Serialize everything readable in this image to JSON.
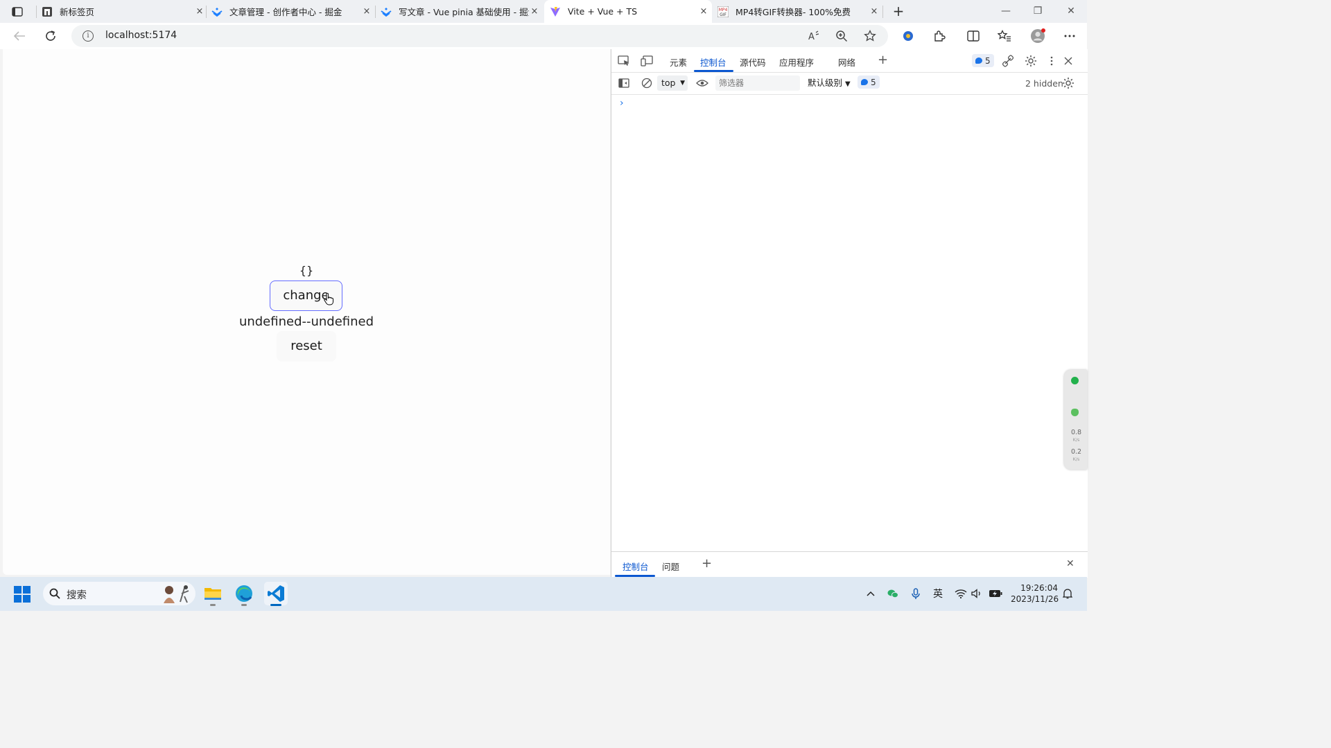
{
  "browser": {
    "tabs": [
      {
        "title": "新标签页",
        "favicon": "newtab-page-icon",
        "active": false
      },
      {
        "title": "文章管理 - 创作者中心 - 掘金",
        "favicon": "juejin-icon",
        "active": false
      },
      {
        "title": "写文章 - Vue pinia 基础使用 - 掘金",
        "favicon": "juejin-icon",
        "active": false
      },
      {
        "title": "Vite + Vue + TS",
        "favicon": "vite-icon",
        "active": true
      },
      {
        "title": "MP4转GIF转换器- 100%免费",
        "favicon": "mp4-gif-icon",
        "active": false
      }
    ],
    "tab_close_glyph": "×",
    "new_tab_glyph": "+",
    "address": "localhost:5174",
    "window_controls": {
      "minimize": "—",
      "maximize": "❐",
      "close": "✕"
    }
  },
  "page": {
    "json_output": "{}",
    "change_button": "change",
    "status_text": "undefined--undefined",
    "reset_button": "reset"
  },
  "devtools": {
    "tabs": [
      "元素",
      "控制台",
      "源代码",
      "应用程序",
      "网络"
    ],
    "active_tab": "控制台",
    "add_tab_glyph": "+",
    "message_count": "5",
    "context": "top",
    "filter_placeholder": "筛选器",
    "log_level": "默认级别",
    "issues_count": "5",
    "hidden_text": "2 hidden",
    "prompt": "›",
    "drawer_tabs": [
      "控制台",
      "问题"
    ],
    "drawer_add": "+",
    "drawer_close": "✕"
  },
  "side_widget": {
    "upload": "0.8",
    "upload_unit": "K/s",
    "download": "0.2",
    "download_unit": "K/s"
  },
  "taskbar": {
    "search_label": "搜索",
    "apps": [
      "file-explorer-icon",
      "edge-icon",
      "vscode-icon"
    ],
    "active_app": "vscode-icon",
    "ime": "英",
    "time": "19:26:04",
    "date": "2023/11/26"
  },
  "colors": {
    "accent": "#0b57d0",
    "vue_button_border": "#646cff",
    "taskbar_bg": "#dfe9f3"
  }
}
